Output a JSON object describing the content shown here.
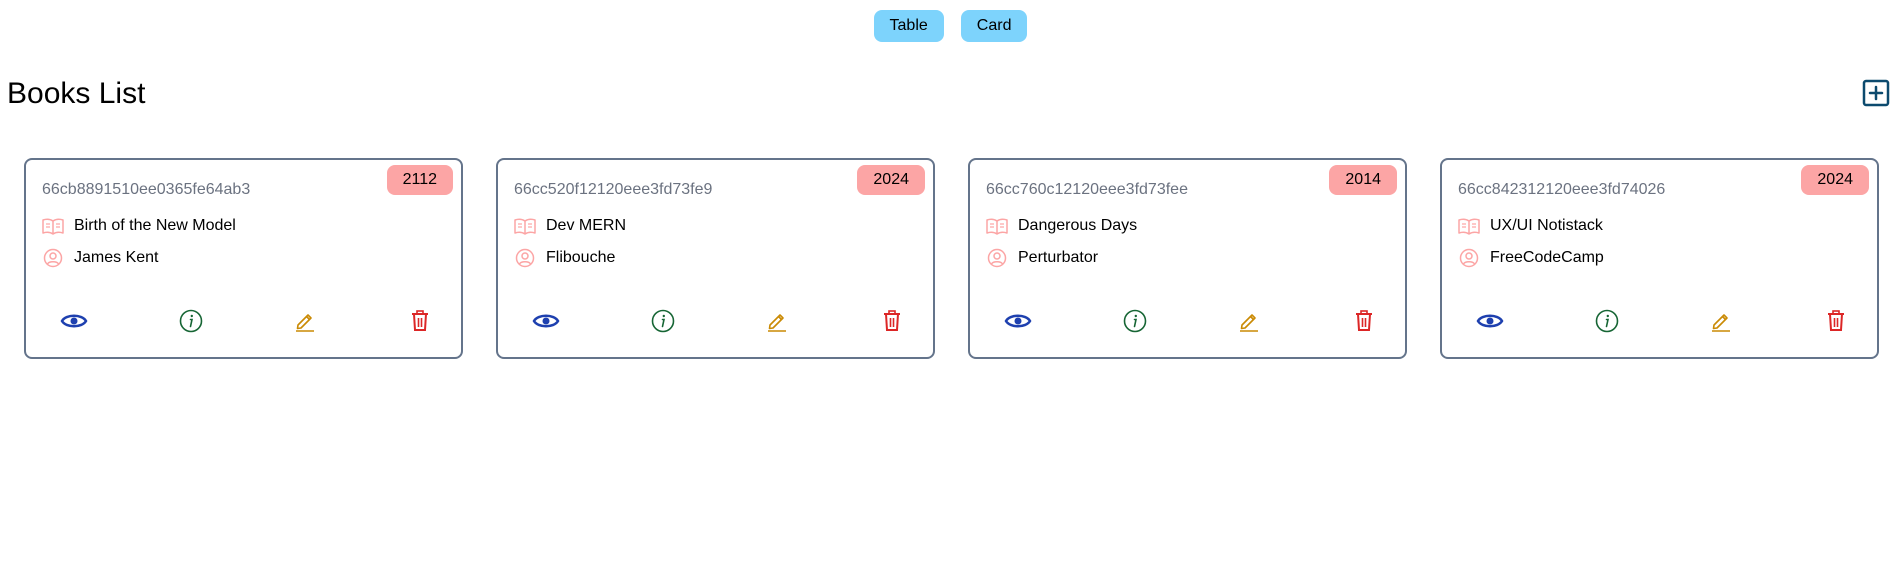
{
  "view_toggle": {
    "table_label": "Table",
    "card_label": "Card"
  },
  "page": {
    "title": "Books List"
  },
  "icons": {
    "add": "plus-square-icon",
    "title": "open-book-icon",
    "author": "user-circle-icon",
    "view": "eye-icon",
    "info": "info-circle-icon",
    "edit": "pencil-icon",
    "delete": "trash-icon"
  },
  "colors": {
    "toggle_bg": "#7dd3fc",
    "badge_bg": "#fca5a5",
    "view_icon": "#1e40af",
    "info_icon": "#166534",
    "edit_icon": "#ca8a04",
    "delete_icon": "#dc2626",
    "add_icon": "#0c4a6e",
    "meta_icon": "#fca5a5"
  },
  "books": [
    {
      "id": "66cb8891510ee0365fe64ab3",
      "year": "2112",
      "title": "Birth of the New Model",
      "author": "James Kent"
    },
    {
      "id": "66cc520f12120eee3fd73fe9",
      "year": "2024",
      "title": "Dev MERN",
      "author": "Flibouche"
    },
    {
      "id": "66cc760c12120eee3fd73fee",
      "year": "2014",
      "title": "Dangerous Days",
      "author": "Perturbator"
    },
    {
      "id": "66cc842312120eee3fd74026",
      "year": "2024",
      "title": "UX/UI Notistack",
      "author": "FreeCodeCamp"
    }
  ]
}
